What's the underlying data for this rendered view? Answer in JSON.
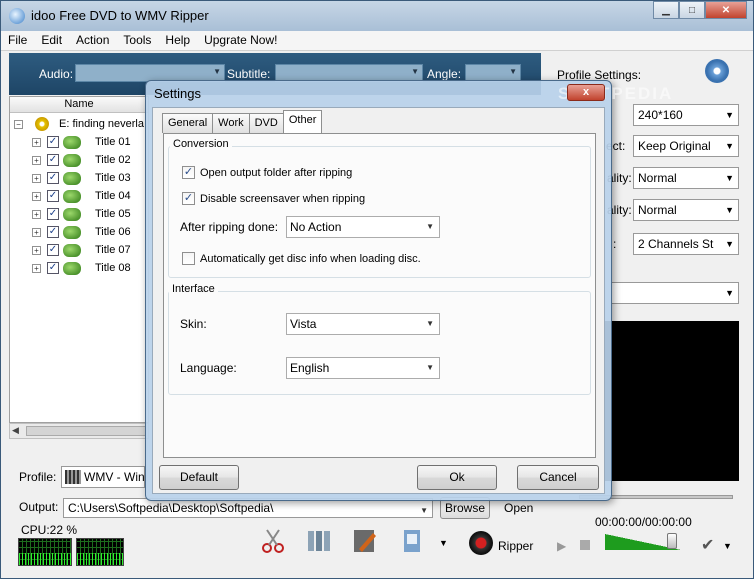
{
  "window": {
    "title": "idoo Free DVD to WMV Ripper"
  },
  "menu": [
    "File",
    "Edit",
    "Action",
    "Tools",
    "Help",
    "Upgrate Now!"
  ],
  "filters": {
    "audio_label": "Audio:",
    "subtitle_label": "Subtitle:",
    "angle_label": "Angle:"
  },
  "tree": {
    "column_name": "Name",
    "disc": "E: finding neverla",
    "titles": [
      "Title 01",
      "Title 02",
      "Title 03",
      "Title 04",
      "Title 05",
      "Title 06",
      "Title 07",
      "Title 08"
    ]
  },
  "bottom": {
    "profile_label": "Profile:",
    "profile_value": "WMV - Win",
    "output_label": "Output:",
    "output_value": "C:\\Users\\Softpedia\\Desktop\\Softpedia\\",
    "browse_label": "Browse",
    "open_label": "Open",
    "cpu_label": "CPU:22 %",
    "ripper_label": "Ripper"
  },
  "right": {
    "profile_settings": "Profile Settings:",
    "resolution": "240*160",
    "aspect_label": "ect:",
    "aspect": "Keep Original",
    "video_quality_label": "ality:",
    "video_quality": "Normal",
    "audio_quality_label": "ality:",
    "audio_quality": "Normal",
    "channels_label": ":",
    "channels": "2 Channels St",
    "time": "00:00:00/00:00:00"
  },
  "dialog": {
    "title": "Settings",
    "watermark": "SOFTPEDIA",
    "close": "x",
    "tabs": [
      "General",
      "Work",
      "DVD",
      "Other"
    ],
    "active_tab": 3,
    "conversion_group": "Conversion",
    "open_output": "Open output folder after ripping",
    "disable_screensaver": "Disable screensaver when ripping",
    "after_ripping_label": "After ripping done:",
    "after_ripping_value": "No Action",
    "auto_disc_info": "Automatically get disc info when loading disc.",
    "interface_group": "Interface",
    "skin_label": "Skin:",
    "skin_value": "Vista",
    "language_label": "Language:",
    "language_value": "English",
    "default_btn": "Default",
    "ok_btn": "Ok",
    "cancel_btn": "Cancel"
  },
  "colors": {
    "accent": "#1e4566",
    "close_red": "#c1432e",
    "cpu_green": "#2ef02e"
  }
}
